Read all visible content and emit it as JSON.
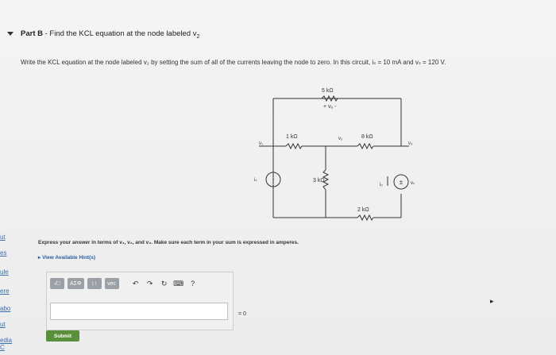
{
  "part": {
    "title_prefix": "Part B",
    "title_text": " - Find the KCL equation at the node labeled v",
    "title_sub": "2"
  },
  "instruction": "Write the KCL equation at the node labeled v₂ by setting the sum of all of the currents leaving the node to zero. In this circuit, iₛ = 10 mA and vₛ = 120 V.",
  "circuit": {
    "r_top": "5 kΩ",
    "v_label": "+ vₒ -",
    "r1": "1 kΩ",
    "v1": "v₁",
    "v2": "v₂",
    "r2": "8 kΩ",
    "v3": "v₃",
    "r3": "3 kΩ",
    "r4": "2 kΩ",
    "is": "iₛ",
    "io": "iₒ",
    "vs": "vₛ"
  },
  "express": "Express your answer in terms of v₁, v₂, and v₃. Make sure each term in your sum is expressed in amperes.",
  "hints": "View Available Hint(s)",
  "toolbar": {
    "b1": "√□",
    "b2": "ΑΣΦ",
    "b3": "↕↑",
    "b4": "vec",
    "undo": "↶",
    "redo": "↷",
    "reset": "↻",
    "keyboard": "⌨",
    "help": "?"
  },
  "equals_zero": "= 0",
  "submit_label": "Submit",
  "left_rail": [
    "ut",
    "es",
    "ule",
    "ere",
    "abo",
    "ut",
    "edia C"
  ]
}
